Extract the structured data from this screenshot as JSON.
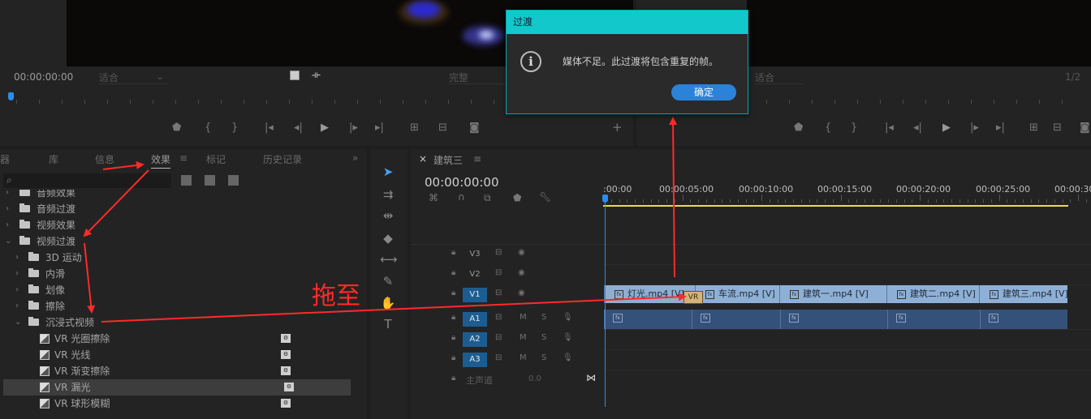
{
  "source_monitor": {
    "timecode": "00:00:00:00",
    "fit_dropdown": "适合",
    "quality_dropdown": "完整"
  },
  "program_monitor": {
    "fit_dropdown": "适合",
    "page_indicator": "1/2"
  },
  "dialog": {
    "title": "过渡",
    "message": "媒体不足。此过渡将包含重复的帧。",
    "ok_label": "确定"
  },
  "effects_panel": {
    "tabs": [
      "器",
      "库",
      "信息",
      "效果",
      "标记",
      "历史记录"
    ],
    "active_tab": "效果",
    "overflow": "»",
    "search_placeholder": "",
    "tree": [
      {
        "label": "音频效果",
        "depth": 0,
        "expanded": false,
        "type": "folder"
      },
      {
        "label": "音频过渡",
        "depth": 0,
        "expanded": false,
        "type": "folder"
      },
      {
        "label": "视频效果",
        "depth": 0,
        "expanded": false,
        "type": "folder"
      },
      {
        "label": "视频过渡",
        "depth": 0,
        "expanded": true,
        "type": "folder"
      },
      {
        "label": "3D 运动",
        "depth": 1,
        "expanded": false,
        "type": "folder"
      },
      {
        "label": "内滑",
        "depth": 1,
        "expanded": false,
        "type": "folder"
      },
      {
        "label": "划像",
        "depth": 1,
        "expanded": false,
        "type": "folder"
      },
      {
        "label": "擦除",
        "depth": 1,
        "expanded": false,
        "type": "folder"
      },
      {
        "label": "沉浸式视频",
        "depth": 1,
        "expanded": true,
        "type": "folder"
      },
      {
        "label": "VR 光圈擦除",
        "depth": 2,
        "type": "effect"
      },
      {
        "label": "VR 光线",
        "depth": 2,
        "type": "effect"
      },
      {
        "label": "VR 渐变擦除",
        "depth": 2,
        "type": "effect"
      },
      {
        "label": "VR 漏光",
        "depth": 2,
        "type": "effect",
        "selected": true
      },
      {
        "label": "VR 球形模糊",
        "depth": 2,
        "type": "effect"
      }
    ]
  },
  "timeline": {
    "close": "×",
    "sequence_name": "建筑三",
    "menu": "≡",
    "timecode": "00:00:00:00",
    "ruler_labels": [
      ":00:00",
      "00:00:05:00",
      "00:00:10:00",
      "00:00:15:00",
      "00:00:20:00",
      "00:00:25:00",
      "00:00:30:"
    ],
    "video_tracks": [
      "V3",
      "V2",
      "V1"
    ],
    "audio_tracks": [
      "A1",
      "A2",
      "A3"
    ],
    "master_label": "主声道",
    "master_value": "0.0",
    "clips": [
      {
        "label": "灯光.mp4 [V]"
      },
      {
        "label": "车流.mp4 [V]"
      },
      {
        "label": "建筑一.mp4 [V]"
      },
      {
        "label": "建筑二.mp4 [V]"
      },
      {
        "label": "建筑三.mp4 [V]"
      }
    ],
    "transition_label": "VR",
    "track_controls": {
      "mute": "M",
      "solo": "S"
    }
  },
  "annotation": {
    "text": "拖至",
    "color": "#ff2a2a"
  },
  "colors": {
    "dialog_title_bar": "#12c8cb",
    "ok_button": "#2b82d9",
    "video_clip": "#8fb0d6",
    "audio_clip": "#34517a",
    "track_target": "#1c5d91",
    "playhead": "#2b8cf0",
    "work_area_bar": "#e8e23a"
  }
}
